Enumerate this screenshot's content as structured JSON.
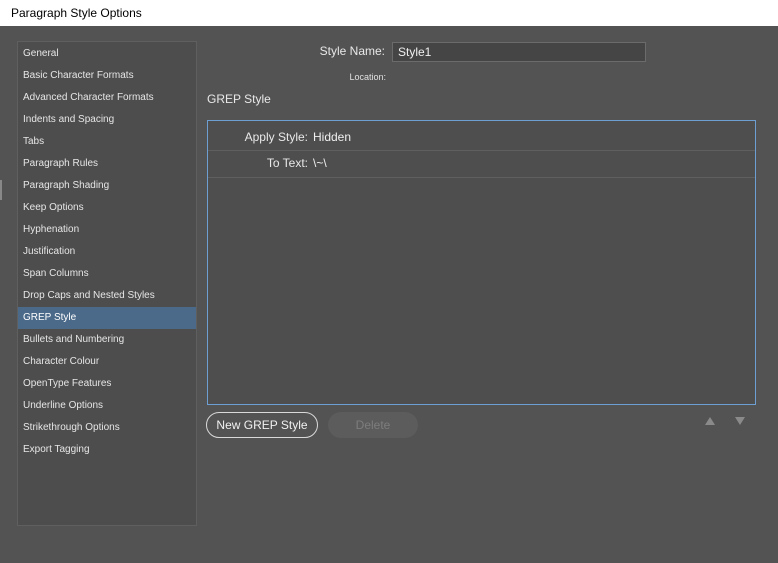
{
  "window": {
    "title": "Paragraph Style Options"
  },
  "sidebar": {
    "selected_index": 12,
    "items": [
      {
        "label": "General"
      },
      {
        "label": "Basic Character Formats"
      },
      {
        "label": "Advanced Character Formats"
      },
      {
        "label": "Indents and Spacing"
      },
      {
        "label": "Tabs"
      },
      {
        "label": "Paragraph Rules"
      },
      {
        "label": "Paragraph Shading"
      },
      {
        "label": "Keep Options"
      },
      {
        "label": "Hyphenation"
      },
      {
        "label": "Justification"
      },
      {
        "label": "Span Columns"
      },
      {
        "label": "Drop Caps and Nested Styles"
      },
      {
        "label": "GREP Style"
      },
      {
        "label": "Bullets and Numbering"
      },
      {
        "label": "Character Colour"
      },
      {
        "label": "OpenType Features"
      },
      {
        "label": "Underline Options"
      },
      {
        "label": "Strikethrough Options"
      },
      {
        "label": "Export Tagging"
      }
    ]
  },
  "style_name": {
    "label": "Style Name:",
    "value": "Style1"
  },
  "location": {
    "label": "Location:"
  },
  "grep": {
    "section_title": "GREP Style",
    "apply_style_label": "Apply Style:",
    "apply_style_value": "Hidden",
    "to_text_label": "To Text:",
    "to_text_value": "\\~\\"
  },
  "buttons": {
    "new_grep_style": "New GREP Style",
    "delete": "Delete"
  },
  "icons": {
    "move_up": "triangle-up-icon",
    "move_down": "triangle-down-icon"
  },
  "colors": {
    "background": "#535353",
    "selection": "#4b6a8a",
    "panel_border": "#6e9fd3"
  }
}
